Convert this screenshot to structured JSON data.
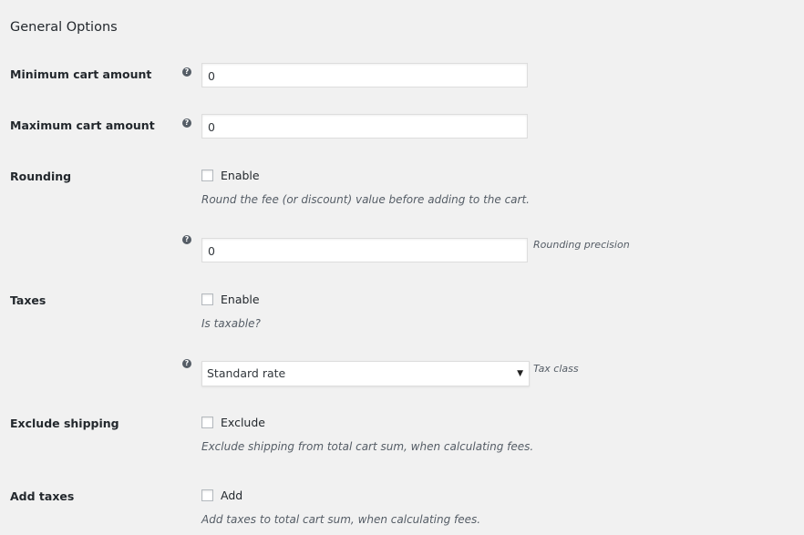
{
  "section_title": "General Options",
  "fields": {
    "min_cart": {
      "label": "Minimum cart amount",
      "value": "0",
      "help_icon": "question-circle-icon"
    },
    "max_cart": {
      "label": "Maximum cart amount",
      "value": "0",
      "help_icon": "question-circle-icon"
    },
    "rounding": {
      "label": "Rounding",
      "checkbox_label": "Enable",
      "checked": false,
      "description": "Round the fee (or discount) value before adding to the cart.",
      "precision_value": "0",
      "precision_description": "Rounding precision",
      "help_icon": "question-circle-icon"
    },
    "taxes": {
      "label": "Taxes",
      "checkbox_label": "Enable",
      "checked": false,
      "description": "Is taxable?",
      "tax_class_value": "Standard rate",
      "tax_class_description": "Tax class",
      "help_icon": "question-circle-icon"
    },
    "exclude_shipping": {
      "label": "Exclude shipping",
      "checkbox_label": "Exclude",
      "checked": false,
      "description": "Exclude shipping from total cart sum, when calculating fees."
    },
    "add_taxes": {
      "label": "Add taxes",
      "checkbox_label": "Add",
      "checked": false,
      "description": "Add taxes to total cart sum, when calculating fees."
    }
  },
  "icons": {
    "help_glyph": "?",
    "dropdown_glyph": "▼"
  }
}
